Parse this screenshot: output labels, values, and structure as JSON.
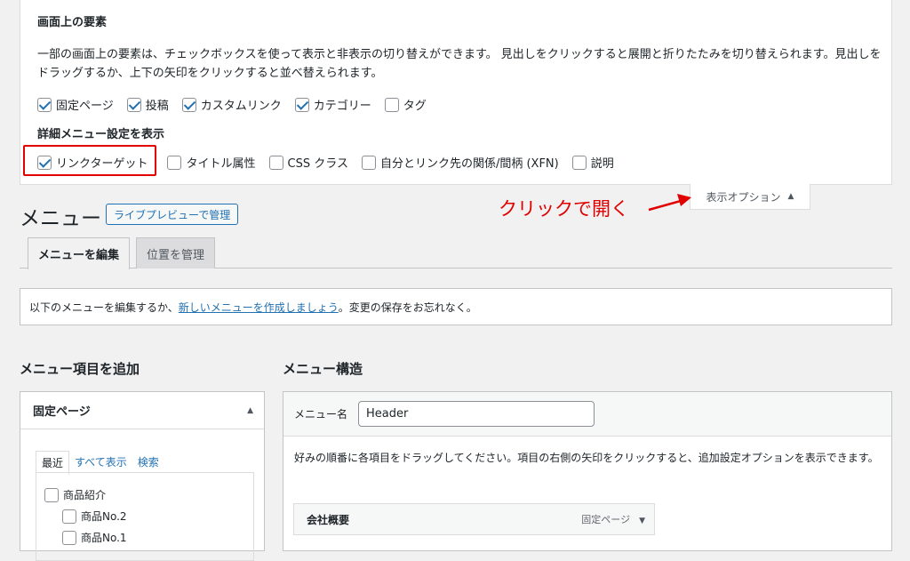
{
  "screen_options": {
    "title": "画面上の要素",
    "description": "一部の画面上の要素は、チェックボックスを使って表示と非表示の切り替えができます。 見出しをクリックすると展開と折りたたみを切り替えられます。見出しをドラッグするか、上下の矢印をクリックすると並べ替えられます。",
    "boxes": [
      {
        "label": "固定ページ",
        "checked": true
      },
      {
        "label": "投稿",
        "checked": true
      },
      {
        "label": "カスタムリンク",
        "checked": true
      },
      {
        "label": "カテゴリー",
        "checked": true
      },
      {
        "label": "タグ",
        "checked": false
      }
    ],
    "advanced_title": "詳細メニュー設定を表示",
    "advanced": [
      {
        "label": "リンクターゲット",
        "checked": true
      },
      {
        "label": "タイトル属性",
        "checked": false
      },
      {
        "label": "CSS クラス",
        "checked": false
      },
      {
        "label": "自分とリンク先の関係/間柄 (XFN)",
        "checked": false
      },
      {
        "label": "説明",
        "checked": false
      }
    ],
    "toggle_label": "表示オプション",
    "toggle_arrow": "▲"
  },
  "annotation": {
    "text": "クリックで開く",
    "color": "#e00000"
  },
  "page": {
    "title": "メニュー",
    "live_preview": "ライブプレビューで管理"
  },
  "tabs": [
    {
      "label": "メニューを編集",
      "active": true
    },
    {
      "label": "位置を管理",
      "active": false
    }
  ],
  "notice": {
    "before": "以下のメニューを編集するか、",
    "link": "新しいメニューを作成しましょう",
    "after": "。変更の保存をお忘れなく。"
  },
  "left": {
    "title": "メニュー項目を追加",
    "panel_title": "固定ページ",
    "panel_arrow": "▲",
    "inner_tabs": [
      "最近",
      "すべて表示",
      "検索"
    ],
    "items": [
      {
        "label": "商品紹介",
        "checked": false
      },
      {
        "label": "商品No.2",
        "checked": false
      },
      {
        "label": "商品No.1",
        "checked": false
      }
    ]
  },
  "right": {
    "title": "メニュー構造",
    "name_label": "メニュー名",
    "name_value": "Header",
    "description": "好みの順番に各項目をドラッグしてください。項目の右側の矢印をクリックすると、追加設定オプションを表示できます。",
    "menu_items": [
      {
        "title": "会社概要",
        "type": "固定ページ",
        "arrow": "▼"
      }
    ]
  },
  "colors": {
    "accent": "#2271b1",
    "highlight": "#e30000"
  }
}
